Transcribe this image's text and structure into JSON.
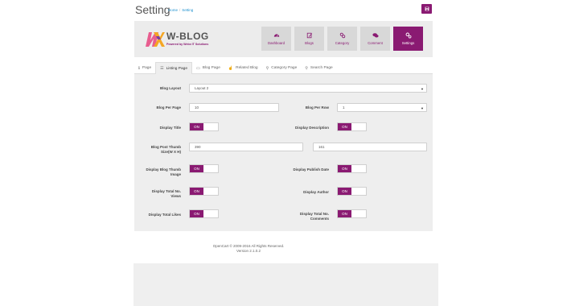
{
  "header": {
    "title": "Setting",
    "breadcrumb": [
      "Home",
      "Setting"
    ],
    "save_icon": "save-icon"
  },
  "brand": {
    "logo_text": "W-BLOG",
    "tagline": "Powered by Webx IT Solutions",
    "accent_color": "#8a1a72"
  },
  "nav": {
    "tiles": [
      {
        "label": "Dashboard",
        "icon": "dashboard-icon"
      },
      {
        "label": "Blogs",
        "icon": "blogs-icon"
      },
      {
        "label": "Category",
        "icon": "category-icon"
      },
      {
        "label": "Comment",
        "icon": "comment-icon"
      },
      {
        "label": "Settings",
        "icon": "settings-icon"
      }
    ]
  },
  "tabs": [
    {
      "label": "Page",
      "icon": "info-icon"
    },
    {
      "label": "Listing Page",
      "icon": "list-icon"
    },
    {
      "label": "Blog Page",
      "icon": "card-icon"
    },
    {
      "label": "Related Blog",
      "icon": "thumbs-up-icon"
    },
    {
      "label": "Category Page",
      "icon": "tag-icon"
    },
    {
      "label": "Search Page",
      "icon": "search-icon"
    }
  ],
  "form": {
    "blog_layout": {
      "label": "Blog Layout",
      "value": "Layout 2"
    },
    "blog_per_page": {
      "label": "Blog Per Page",
      "value": "10"
    },
    "blog_per_row": {
      "label": "Blog Per Row",
      "value": "1"
    },
    "display_title": {
      "label": "Display Title",
      "toggle": "ON"
    },
    "display_description": {
      "label": "Display Description",
      "toggle": "ON"
    },
    "thumb_size": {
      "label_line1": "Blog Post Thumb",
      "label_line2": "Size(W X H)",
      "width": "390",
      "height": "161"
    },
    "display_thumb_image": {
      "label_line1": "Display Blog Thumb",
      "label_line2": "Image",
      "toggle": "ON"
    },
    "display_publish_date": {
      "label": "Display Publish Date",
      "toggle": "ON"
    },
    "display_total_views": {
      "label_line1": "Display Total No.",
      "label_line2": "Views",
      "toggle": "ON"
    },
    "display_author": {
      "label": "Display Author",
      "toggle": "ON"
    },
    "display_total_likes": {
      "label": "Display Total Likes",
      "toggle": "ON"
    },
    "display_total_comments": {
      "label_line1": "Display Total No.",
      "label_line2": "Comments",
      "toggle": "ON"
    }
  },
  "footer": {
    "copyright": "OpenCart © 2009-2016 All Rights Reserved.",
    "version": "Version 2.1.0.2"
  }
}
